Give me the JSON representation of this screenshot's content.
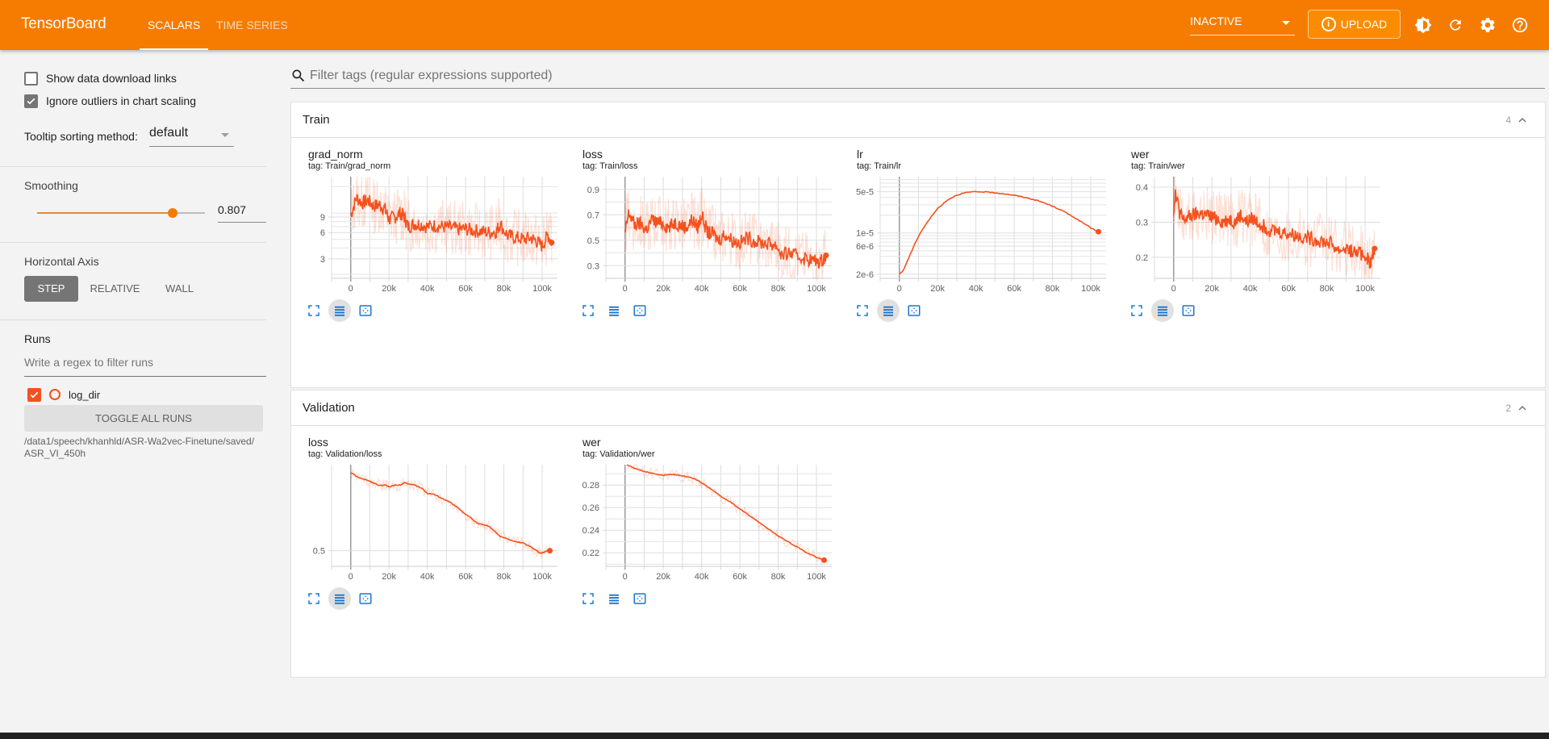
{
  "header": {
    "brand": "TensorBoard",
    "tabs": [
      {
        "label": "SCALARS",
        "active": true
      },
      {
        "label": "TIME SERIES",
        "active": false
      }
    ],
    "run_selector": "INACTIVE",
    "upload_label": "UPLOAD",
    "icons": [
      "brightness-icon",
      "refresh-icon",
      "settings-icon",
      "help-icon"
    ],
    "accent_color": "#f57c00"
  },
  "sidebar": {
    "show_download_links": {
      "label": "Show data download links",
      "checked": false
    },
    "ignore_outliers": {
      "label": "Ignore outliers in chart scaling",
      "checked": true
    },
    "tooltip_sorting": {
      "label": "Tooltip sorting method:",
      "value": "default"
    },
    "smoothing": {
      "label": "Smoothing",
      "value": "0.807",
      "fraction": 0.807
    },
    "horizontal_axis": {
      "label": "Horizontal Axis",
      "options": [
        "STEP",
        "RELATIVE",
        "WALL"
      ],
      "selected": "STEP"
    },
    "runs": {
      "label": "Runs",
      "filter_placeholder": "Write a regex to filter runs",
      "items": [
        {
          "name": "log_dir",
          "checked": true,
          "color": "#f4511e"
        }
      ],
      "toggle_all": "TOGGLE ALL RUNS",
      "path": "/data1/speech/khanhld/ASR-Wa2vec-Finetune/saved/ASR_VI_450h"
    }
  },
  "main": {
    "filter_placeholder": "Filter tags (regular expressions supported)",
    "groups": [
      {
        "title": "Train",
        "count": "4"
      },
      {
        "title": "Validation",
        "count": "2"
      }
    ]
  },
  "chart_data": [
    {
      "type": "line",
      "group": "Train",
      "title": "grad_norm",
      "tag": "tag: Train/grad_norm",
      "xlabel": "",
      "ylabel": "",
      "yscale": "log",
      "xlim": [
        -10000,
        108000
      ],
      "ylim": [
        1.8,
        26
      ],
      "xticks": [
        0,
        20000,
        40000,
        60000,
        80000,
        100000
      ],
      "xtick_labels": [
        "0",
        "20k",
        "40k",
        "60k",
        "80k",
        "100k"
      ],
      "yticks": [
        3,
        6,
        9
      ],
      "ytick_labels": [
        "3",
        "6",
        "9"
      ],
      "yminor": [
        2,
        4,
        5,
        7,
        8,
        10,
        20
      ],
      "x": [
        0,
        3000,
        6000,
        9000,
        12000,
        15000,
        18000,
        20000,
        23000,
        26000,
        28000,
        30000,
        33000,
        36000,
        40000,
        44000,
        48000,
        52000,
        56000,
        60000,
        64000,
        68000,
        72000,
        76000,
        78000,
        82000,
        86000,
        90000,
        94000,
        97000,
        100000,
        103000,
        105000
      ],
      "smoothed": [
        9.5,
        15,
        13,
        14,
        12,
        12.5,
        11,
        8.5,
        9,
        10,
        9,
        7,
        7.5,
        7.5,
        7,
        7.2,
        7,
        6.8,
        6.5,
        6.6,
        6.3,
        6.2,
        6.0,
        6.2,
        7.5,
        5.5,
        5.3,
        5.0,
        5.2,
        4.8,
        4.2,
        5.6,
        4.6
      ],
      "series": [
        {
          "name": "log_dir",
          "color": "#f4511e"
        }
      ]
    },
    {
      "type": "line",
      "group": "Train",
      "title": "loss",
      "tag": "tag: Train/loss",
      "xlim": [
        -10000,
        108000
      ],
      "ylim": [
        0.2,
        1.0
      ],
      "xticks": [
        0,
        20000,
        40000,
        60000,
        80000,
        100000
      ],
      "xtick_labels": [
        "0",
        "20k",
        "40k",
        "60k",
        "80k",
        "100k"
      ],
      "yticks": [
        0.3,
        0.5,
        0.7,
        0.9
      ],
      "ytick_labels": [
        "0.3",
        "0.5",
        "0.7",
        "0.9"
      ],
      "yminor": [
        0.4,
        0.6,
        0.8
      ],
      "x": [
        0,
        2000,
        5000,
        8000,
        11000,
        14000,
        17000,
        20000,
        23000,
        26000,
        29000,
        32000,
        35000,
        38000,
        40000,
        43000,
        46000,
        49000,
        52000,
        56000,
        60000,
        64000,
        68000,
        72000,
        76000,
        79000,
        82000,
        86000,
        90000,
        94000,
        98000,
        102000,
        105000
      ],
      "smoothed": [
        0.55,
        0.72,
        0.62,
        0.63,
        0.58,
        0.66,
        0.64,
        0.63,
        0.6,
        0.64,
        0.62,
        0.6,
        0.66,
        0.6,
        0.7,
        0.56,
        0.55,
        0.5,
        0.55,
        0.5,
        0.48,
        0.52,
        0.49,
        0.48,
        0.47,
        0.46,
        0.38,
        0.4,
        0.37,
        0.36,
        0.34,
        0.33,
        0.38
      ],
      "series": [
        {
          "name": "log_dir",
          "color": "#f4511e"
        }
      ]
    },
    {
      "type": "line",
      "group": "Train",
      "title": "lr",
      "tag": "tag: Train/lr",
      "yscale": "log",
      "xlim": [
        -10000,
        108000
      ],
      "ylim": [
        1.7e-06,
        9e-05
      ],
      "xticks": [
        0,
        20000,
        40000,
        60000,
        80000,
        100000
      ],
      "xtick_labels": [
        "0",
        "20k",
        "40k",
        "60k",
        "80k",
        "100k"
      ],
      "yticks": [
        2e-06,
        6e-06,
        1e-05,
        5e-05
      ],
      "ytick_labels": [
        "2e-6",
        "6e-6",
        "1e-5",
        "5e-5"
      ],
      "yminor": [
        3e-06,
        4e-06,
        5e-06,
        7e-06,
        8e-06,
        9e-06,
        2e-05,
        3e-05,
        4e-05,
        6e-05,
        7e-05,
        8e-05
      ],
      "x": [
        0,
        2000,
        5000,
        8000,
        11000,
        15000,
        20000,
        25000,
        30000,
        35000,
        40000,
        45000,
        50000,
        55000,
        60000,
        65000,
        70000,
        75000,
        80000,
        85000,
        90000,
        95000,
        100000,
        104000
      ],
      "smoothed": [
        2e-06,
        2.3e-06,
        3.8e-06,
        6.5e-06,
        1e-05,
        1.6e-05,
        2.6e-05,
        3.6e-05,
        4.4e-05,
        4.85e-05,
        5e-05,
        4.95e-05,
        4.8e-05,
        4.6e-05,
        4.35e-05,
        4.05e-05,
        3.7e-05,
        3.3e-05,
        2.85e-05,
        2.4e-05,
        1.95e-05,
        1.55e-05,
        1.22e-05,
        1.05e-05
      ],
      "series": [
        {
          "name": "log_dir",
          "color": "#f4511e"
        }
      ]
    },
    {
      "type": "line",
      "group": "Train",
      "title": "wer",
      "tag": "tag: Train/wer",
      "xlim": [
        -10000,
        108000
      ],
      "ylim": [
        0.14,
        0.43
      ],
      "xticks": [
        0,
        20000,
        40000,
        60000,
        80000,
        100000
      ],
      "xtick_labels": [
        "0",
        "20k",
        "40k",
        "60k",
        "80k",
        "100k"
      ],
      "yticks": [
        0.2,
        0.3,
        0.4
      ],
      "ytick_labels": [
        "0.2",
        "0.3",
        "0.4"
      ],
      "yminor": [],
      "x": [
        0,
        1000,
        3000,
        5000,
        8000,
        11000,
        14000,
        17000,
        20000,
        23000,
        26000,
        29000,
        32000,
        35000,
        38000,
        41000,
        44000,
        47000,
        50000,
        54000,
        58000,
        62000,
        66000,
        70000,
        74000,
        78000,
        82000,
        86000,
        90000,
        94000,
        98000,
        101000,
        103000,
        105000
      ],
      "smoothed": [
        0.33,
        0.39,
        0.33,
        0.305,
        0.315,
        0.32,
        0.325,
        0.32,
        0.315,
        0.31,
        0.3,
        0.31,
        0.3,
        0.32,
        0.3,
        0.31,
        0.3,
        0.29,
        0.28,
        0.275,
        0.27,
        0.265,
        0.26,
        0.255,
        0.25,
        0.245,
        0.24,
        0.22,
        0.225,
        0.215,
        0.21,
        0.2,
        0.18,
        0.225
      ],
      "series": [
        {
          "name": "log_dir",
          "color": "#f4511e"
        }
      ]
    },
    {
      "type": "line",
      "group": "Validation",
      "title": "loss",
      "tag": "tag: Validation/loss",
      "xlim": [
        -10000,
        108000
      ],
      "ylim": [
        0.44,
        0.83
      ],
      "xticks": [
        0,
        20000,
        40000,
        60000,
        80000,
        100000
      ],
      "xtick_labels": [
        "0",
        "20k",
        "40k",
        "60k",
        "80k",
        "100k"
      ],
      "yticks": [
        0.5
      ],
      "ytick_labels": [
        "0.5"
      ],
      "yminor": [],
      "x": [
        0,
        3000,
        6000,
        9000,
        12000,
        15000,
        18000,
        20000,
        23000,
        26000,
        28000,
        31000,
        34000,
        37000,
        40000,
        44000,
        48000,
        52000,
        56000,
        60000,
        63000,
        66000,
        69000,
        72000,
        75000,
        78000,
        82000,
        86000,
        90000,
        94000,
        97000,
        99000,
        101000,
        104000
      ],
      "smoothed": [
        0.8,
        0.785,
        0.775,
        0.77,
        0.76,
        0.75,
        0.752,
        0.745,
        0.752,
        0.752,
        0.762,
        0.755,
        0.75,
        0.74,
        0.72,
        0.715,
        0.7,
        0.685,
        0.665,
        0.64,
        0.625,
        0.605,
        0.6,
        0.595,
        0.575,
        0.555,
        0.545,
        0.535,
        0.53,
        0.515,
        0.5,
        0.49,
        0.495,
        0.5
      ],
      "series": [
        {
          "name": "log_dir",
          "color": "#f4511e"
        }
      ]
    },
    {
      "type": "line",
      "group": "Validation",
      "title": "wer",
      "tag": "tag: Validation/wer",
      "xlim": [
        -10000,
        108000
      ],
      "ylim": [
        0.208,
        0.298
      ],
      "xticks": [
        0,
        20000,
        40000,
        60000,
        80000,
        100000
      ],
      "xtick_labels": [
        "0",
        "20k",
        "40k",
        "60k",
        "80k",
        "100k"
      ],
      "yticks": [
        0.22,
        0.24,
        0.26,
        0.28
      ],
      "ytick_labels": [
        "0.22",
        "0.24",
        "0.26",
        "0.28"
      ],
      "yminor": [
        0.21,
        0.23,
        0.25,
        0.27,
        0.29
      ],
      "x": [
        1000,
        5000,
        10000,
        15000,
        20000,
        25000,
        30000,
        34000,
        38000,
        42000,
        46000,
        50000,
        55000,
        60000,
        65000,
        70000,
        75000,
        80000,
        85000,
        90000,
        95000,
        100000,
        104000
      ],
      "smoothed": [
        0.298,
        0.295,
        0.292,
        0.29,
        0.2885,
        0.2895,
        0.288,
        0.287,
        0.284,
        0.28,
        0.275,
        0.27,
        0.265,
        0.259,
        0.253,
        0.247,
        0.241,
        0.235,
        0.23,
        0.225,
        0.22,
        0.216,
        0.2135
      ],
      "series": [
        {
          "name": "log_dir",
          "color": "#f4511e"
        }
      ]
    }
  ]
}
